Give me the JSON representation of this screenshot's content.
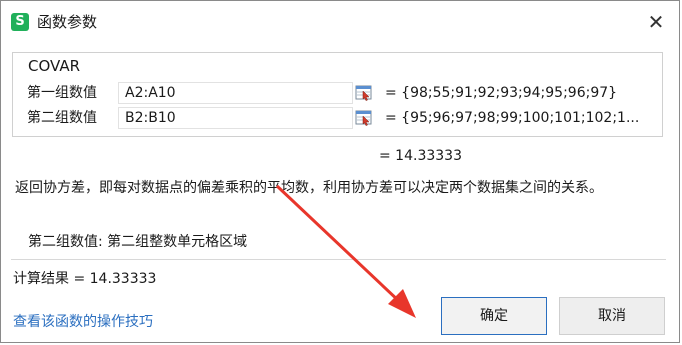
{
  "titlebar": {
    "title": "函数参数",
    "app_icon_letter": "S",
    "app_icon_color": "#21b05b"
  },
  "function": {
    "name": "COVAR"
  },
  "arguments": [
    {
      "label": "第一组数值",
      "input": "A2:A10",
      "value": "= {98;55;91;92;93;94;95;96;97}"
    },
    {
      "label": "第二组数值",
      "input": "B2:B10",
      "value": "= {95;96;97;98;99;100;101;102;1..."
    }
  ],
  "function_result": "= 14.33333",
  "description": "返回协方差，即每对数据点的偏差乘积的平均数，利用协方差可以决定两个数据集之间的关系。",
  "argument_description": "第二组数值:  第二组整数单元格区域",
  "calc_result": "计算结果 = 14.33333",
  "help_link": "查看该函数的操作技巧",
  "buttons": {
    "ok": "确定",
    "cancel": "取消"
  },
  "annotation": {
    "arrow_color": "#e8362b"
  },
  "colors": {
    "link": "#2b6fc0",
    "focus_border": "#2b6fc0"
  }
}
